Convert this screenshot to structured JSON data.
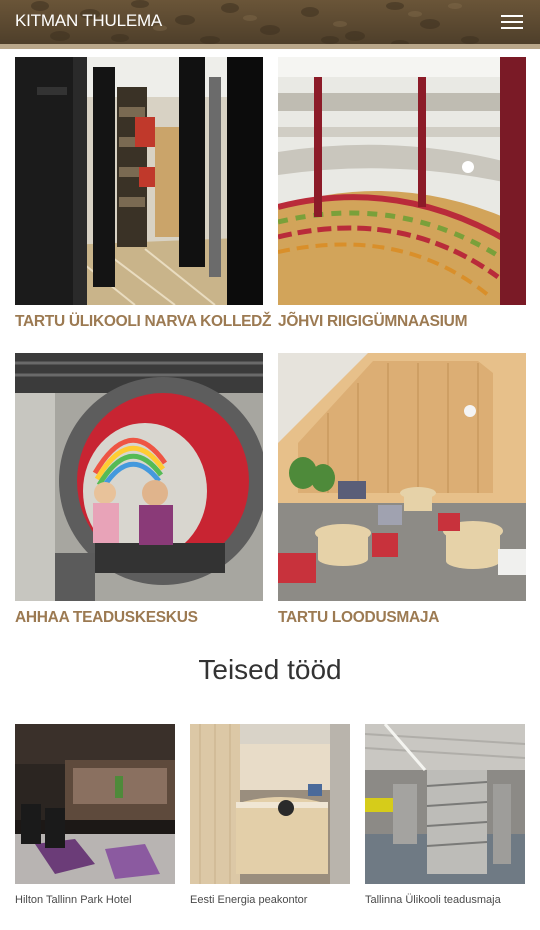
{
  "header": {
    "logo": "KITMAN THULEMA",
    "menu_icon": "hamburger-menu-icon",
    "colors": {
      "bar": "#5a4830",
      "strip": "#b9a78a"
    }
  },
  "projects": [
    {
      "title": "TARTU ÜLIKOOLI NARVA KOLLEDŽ",
      "image": "library-bookshelves-photo"
    },
    {
      "title": "JÕHVI RIIGIGÜMNAASIUM",
      "image": "atrium-amphitheater-photo"
    },
    {
      "title": "AHHAA TEADUSKESKUS",
      "image": "red-ring-seat-photo"
    },
    {
      "title": "TARTU LOODUSMAJA",
      "image": "wooden-room-stools-photo"
    }
  ],
  "other_works": {
    "heading": "Teised tööd",
    "items": [
      {
        "caption": "Hilton Tallinn Park Hotel",
        "image": "hotel-lobby-photo"
      },
      {
        "caption": "Eesti Energia peakontor",
        "image": "reception-desk-photo"
      },
      {
        "caption": "Tallinna Ülikooli teadusmaja",
        "image": "metal-shelves-photo"
      }
    ]
  },
  "colors": {
    "accent": "#9c7a52",
    "heading": "#333333",
    "caption": "#4a4a4a"
  }
}
